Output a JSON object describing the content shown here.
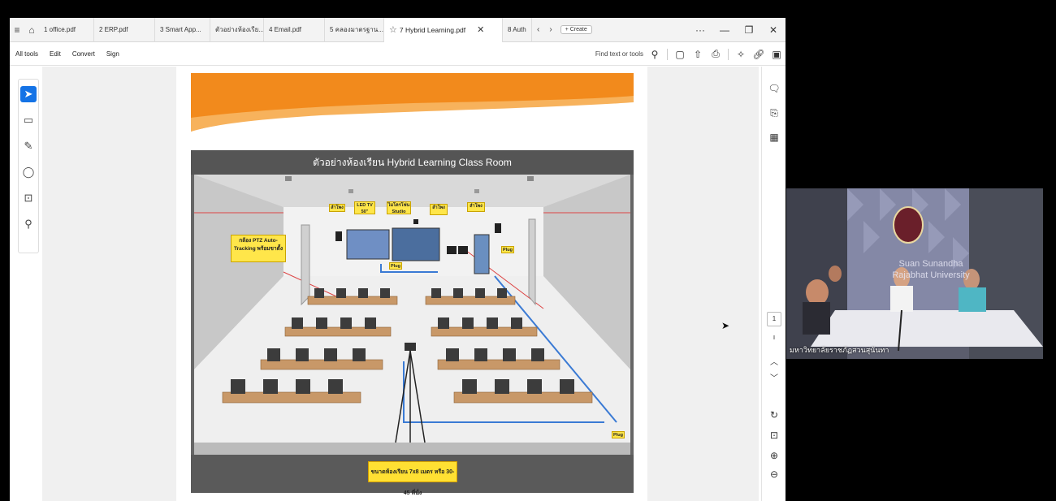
{
  "tabs": [
    {
      "label": "1 office.pdf"
    },
    {
      "label": "2 ERP.pdf"
    },
    {
      "label": "3 Smart App..."
    },
    {
      "label": "ตัวอย่างห้องเรีย..."
    },
    {
      "label": "4 Email.pdf"
    },
    {
      "label": "5 คลองมาตรฐาน..."
    },
    {
      "label": "7 Hybrid Learning.pdf"
    },
    {
      "label": "8 Auth"
    }
  ],
  "tabbar": {
    "create_label": "+ Create",
    "more": "···"
  },
  "toolbar": {
    "menu": [
      "All tools",
      "Edit",
      "Convert",
      "Sign"
    ],
    "find_label": "Find text or tools"
  },
  "slide": {
    "title": "ตัวอย่างห้องเรียน Hybrid Learning Class Room",
    "ptz_label": "กล้อง PTZ Auto-Tracking พร้อมขาตั้ง",
    "footer_label": "ขนาดห้องเรียน 7x8 เมตร หรือ 30-45 ที่นั่ง",
    "tags": [
      "ลำโพง",
      "LED TV 50\"",
      "ไมโครโฟน Studio",
      "ลำโพง",
      "ลำโพง",
      "Plug",
      "Plug",
      "Plug"
    ]
  },
  "right_panel": {
    "page_number": "1"
  },
  "video": {
    "caption": "มหาวิทยาลัยราชภัฏสวนสุนันทา",
    "wall_text_1": "Suan Sunandha",
    "wall_text_2": "Rajabhat University"
  },
  "colors": {
    "accent": "#1473e6",
    "orange": "#f28a1c",
    "yellow_label": "#ffe64a"
  }
}
